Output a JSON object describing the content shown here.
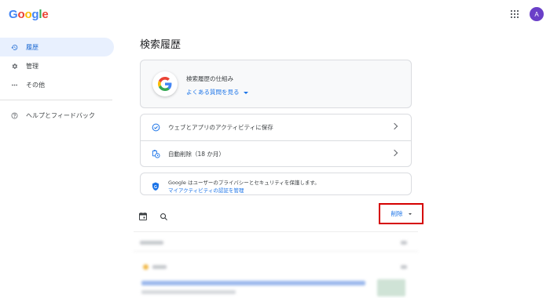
{
  "header": {
    "logo_letters": [
      {
        "char": "G",
        "color": "#4285f4"
      },
      {
        "char": "o",
        "color": "#ea4335"
      },
      {
        "char": "o",
        "color": "#fbbc05"
      },
      {
        "char": "g",
        "color": "#4285f4"
      },
      {
        "char": "l",
        "color": "#34a853"
      },
      {
        "char": "e",
        "color": "#ea4335"
      }
    ],
    "apps_icon": "apps-grid-icon",
    "avatar_initial": "A",
    "avatar_color": "#6a3fc8"
  },
  "sidebar": {
    "items": [
      {
        "label": "履歴",
        "icon": "history-icon",
        "active": true
      },
      {
        "label": "管理",
        "icon": "gear-icon",
        "active": false
      },
      {
        "label": "その他",
        "icon": "more-horiz-icon",
        "active": false
      },
      {
        "label": "ヘルプとフィードバック",
        "icon": "help-icon",
        "active": false
      }
    ]
  },
  "main": {
    "title": "検索履歴",
    "info_card": {
      "title": "検索履歴の仕組み",
      "link": "よくある質問を見る"
    },
    "settings": [
      {
        "label": "ウェブとアプリのアクティビティに保存",
        "icon": "check-circle-icon"
      },
      {
        "label": "自動削除（18 か月）",
        "icon": "auto-delete-icon"
      }
    ],
    "privacy": {
      "text": "Google はユーザーのプライバシーとセキュリティを保護します。",
      "link": "マイアクティビティの認証を管理"
    },
    "toolbar": {
      "delete_label": "削除"
    }
  },
  "colors": {
    "accent": "#1a73e8",
    "active_bg": "#e8f0fe",
    "highlight_border": "#d50000"
  }
}
